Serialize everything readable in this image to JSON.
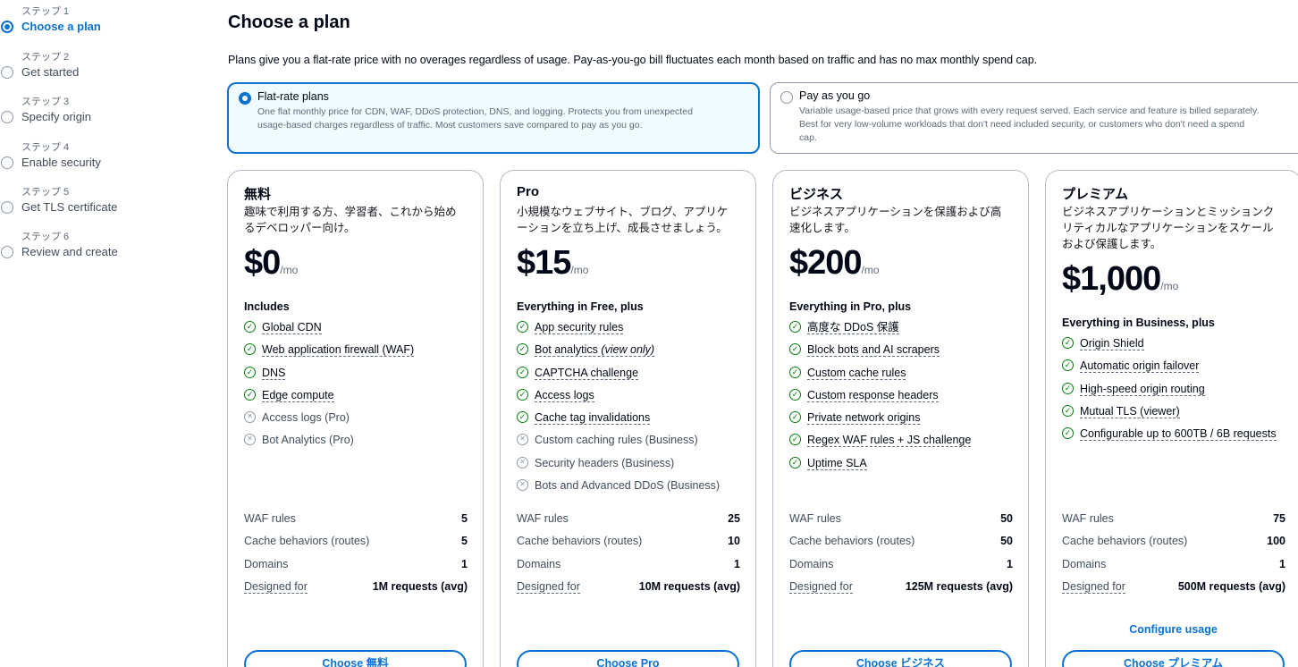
{
  "steps": [
    {
      "num": "ステップ 1",
      "label": "Choose a plan",
      "active": true
    },
    {
      "num": "ステップ 2",
      "label": "Get started",
      "active": false
    },
    {
      "num": "ステップ 3",
      "label": "Specify origin",
      "active": false
    },
    {
      "num": "ステップ 4",
      "label": "Enable security",
      "active": false
    },
    {
      "num": "ステップ 5",
      "label": "Get TLS certificate",
      "active": false
    },
    {
      "num": "ステップ 6",
      "label": "Review and create",
      "active": false
    }
  ],
  "page": {
    "title": "Choose a plan",
    "description": "Plans give you a flat-rate price with no overages regardless of usage. Pay-as-you-go bill fluctuates each month based on traffic and has no max monthly spend cap."
  },
  "billing_options": [
    {
      "title": "Flat-rate plans",
      "selected": true,
      "desc_lines": [
        "One flat monthly price for CDN, WAF, DDoS protection, DNS, and logging. Protects you from unexpected",
        "usage-based charges regardless of traffic. Most customers save compared to pay as you go."
      ]
    },
    {
      "title": "Pay as you go",
      "selected": false,
      "desc_lines": [
        "Variable usage-based price that grows with every request served. Each service and feature is billed separately.",
        "Best for very low-volume workloads that don't need included security, or customers who don't need a spend",
        "cap."
      ]
    }
  ],
  "colors": {
    "accent": "#0972d3",
    "check": "#037f0c",
    "muted_icon": "#8d99a8"
  },
  "plans": [
    {
      "name": "無料",
      "sub_lines": [
        "趣味で利用する方、学習者、これから始め",
        "るデベロッパー向け。"
      ],
      "price": "$0",
      "unit": "/mo",
      "features_heading": "Includes",
      "features": [
        {
          "text": "Global CDN",
          "icon": "check-circle-icon"
        },
        {
          "text": "Web application firewall (WAF)",
          "icon": "check-circle-icon"
        },
        {
          "text": "DNS",
          "icon": "check-circle-icon"
        },
        {
          "text": "Edge compute",
          "icon": "check-circle-icon"
        },
        {
          "text": "Access logs (Pro)",
          "icon": "x-circle-icon"
        },
        {
          "text": "Bot Analytics (Pro)",
          "icon": "x-circle-icon"
        }
      ],
      "metrics": [
        {
          "label": "WAF rules",
          "value": "5"
        },
        {
          "label": "Cache behaviors (routes)",
          "value": "5"
        },
        {
          "label": "Domains",
          "value": "1"
        },
        {
          "label": "Designed for",
          "value": "1M requests (avg)"
        }
      ],
      "configure_label": "",
      "button_label": "Choose 無料"
    },
    {
      "name": "Pro",
      "sub_lines": [
        "小規模なウェブサイト、ブログ、アプリケ",
        "ーションを立ち上げ、成長させましょう。"
      ],
      "price": "$15",
      "unit": "/mo",
      "features_heading": "Everything in Free, plus",
      "features": [
        {
          "text": "App security rules",
          "icon": "check-circle-icon"
        },
        {
          "text": "Bot analytics",
          "note": "(view only)",
          "icon": "check-circle-icon"
        },
        {
          "text": "CAPTCHA challenge",
          "icon": "check-circle-icon"
        },
        {
          "text": "Access logs",
          "icon": "check-circle-icon"
        },
        {
          "text": "Cache tag invalidations",
          "icon": "check-circle-icon"
        },
        {
          "text": "Custom caching rules (Business)",
          "icon": "x-circle-icon"
        },
        {
          "text": "Security headers (Business)",
          "icon": "x-circle-icon"
        },
        {
          "text": "Bots and Advanced DDoS (Business)",
          "icon": "x-circle-icon"
        }
      ],
      "metrics": [
        {
          "label": "WAF rules",
          "value": "25"
        },
        {
          "label": "Cache behaviors (routes)",
          "value": "10"
        },
        {
          "label": "Domains",
          "value": "1"
        },
        {
          "label": "Designed for",
          "value": "10M requests (avg)"
        }
      ],
      "configure_label": "",
      "button_label": "Choose Pro"
    },
    {
      "name": "ビジネス",
      "sub_lines": [
        "ビジネスアプリケーションを保護および高",
        "速化します。"
      ],
      "price": "$200",
      "unit": "/mo",
      "features_heading": "Everything in Pro, plus",
      "features": [
        {
          "text": "高度な DDoS 保護",
          "icon": "check-circle-icon"
        },
        {
          "text": "Block bots and AI scrapers",
          "icon": "check-circle-icon"
        },
        {
          "text": "Custom cache rules",
          "icon": "check-circle-icon"
        },
        {
          "text": "Custom response headers",
          "icon": "check-circle-icon"
        },
        {
          "text": "Private network origins",
          "icon": "check-circle-icon"
        },
        {
          "text": "Regex WAF rules + JS challenge",
          "icon": "check-circle-icon"
        },
        {
          "text": "Uptime SLA",
          "icon": "check-circle-icon"
        }
      ],
      "metrics": [
        {
          "label": "WAF rules",
          "value": "50"
        },
        {
          "label": "Cache behaviors (routes)",
          "value": "50"
        },
        {
          "label": "Domains",
          "value": "1"
        },
        {
          "label": "Designed for",
          "value": "125M requests (avg)"
        }
      ],
      "configure_label": "",
      "button_label": "Choose ビジネス"
    },
    {
      "name": "プレミアム",
      "sub_lines": [
        "ビジネスアプリケーションとミッションク",
        "リティカルなアプリケーションをスケール",
        "および保護します。"
      ],
      "price": "$1,000",
      "unit": "/mo",
      "features_heading": "Everything in Business, plus",
      "features": [
        {
          "text": "Origin Shield",
          "icon": "check-circle-icon"
        },
        {
          "text": "Automatic origin failover",
          "icon": "check-circle-icon"
        },
        {
          "text": "High-speed origin routing",
          "icon": "check-circle-icon"
        },
        {
          "text": "Mutual TLS (viewer)",
          "icon": "check-circle-icon"
        },
        {
          "text": "Configurable up to 600TB / 6B requests",
          "icon": "check-circle-icon"
        }
      ],
      "metrics": [
        {
          "label": "WAF rules",
          "value": "75"
        },
        {
          "label": "Cache behaviors (routes)",
          "value": "100"
        },
        {
          "label": "Domains",
          "value": "1"
        },
        {
          "label": "Designed for",
          "value": "500M requests (avg)"
        }
      ],
      "configure_label": "Configure usage",
      "button_label": "Choose プレミアム"
    }
  ]
}
